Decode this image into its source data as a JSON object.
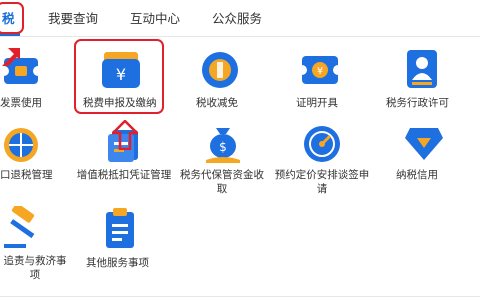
{
  "tabs": [
    {
      "label": "税"
    },
    {
      "label": "我要查询"
    },
    {
      "label": "互动中心"
    },
    {
      "label": "公众服务"
    }
  ],
  "grid": {
    "items": [
      {
        "label": "发票使用"
      },
      {
        "label": "税费申报及缴纳"
      },
      {
        "label": "税收减免"
      },
      {
        "label": "证明开具"
      },
      {
        "label": "税务行政许可"
      },
      {
        "label": "口退税管理"
      },
      {
        "label": "增值税抵扣凭证管理"
      },
      {
        "label": "税务代保管资金收取"
      },
      {
        "label": "预约定价安排谈签申请"
      },
      {
        "label": "纳税信用"
      },
      {
        "label": "追责与救济事项"
      },
      {
        "label": "其他服务事项"
      }
    ]
  },
  "colors": {
    "accent": "#1a6fd6",
    "highlight": "#e0202a",
    "icon_blue": "#1e6fe0",
    "icon_orange": "#f5a623"
  }
}
